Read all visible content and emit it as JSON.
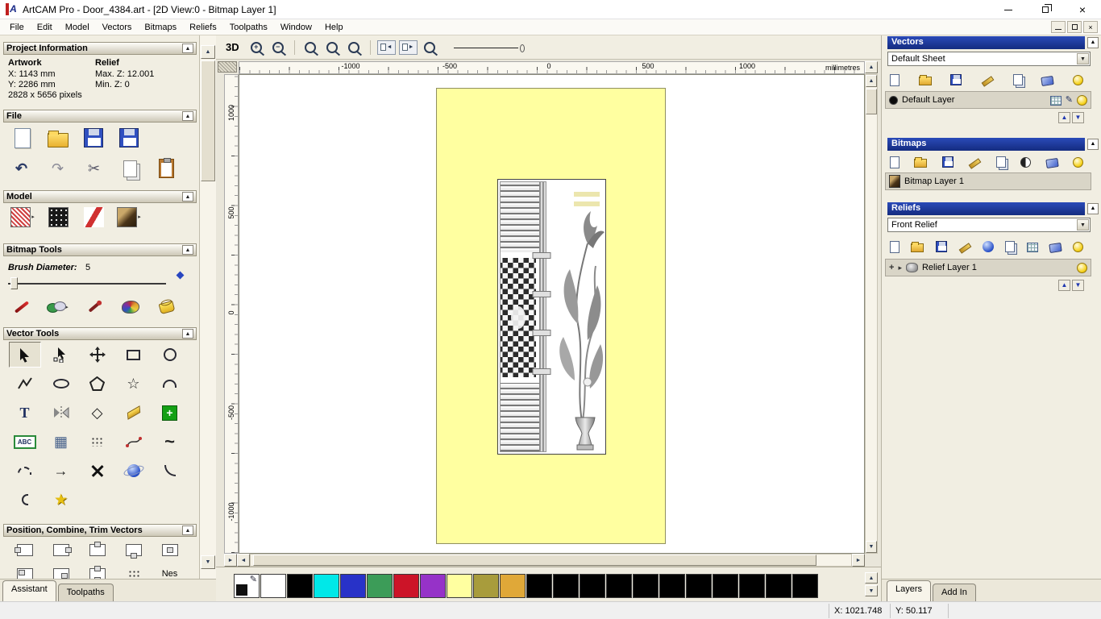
{
  "window": {
    "title": "ArtCAM Pro - Door_4384.art - [2D View:0 - Bitmap Layer 1]"
  },
  "menu": {
    "items": [
      "File",
      "Edit",
      "Model",
      "Vectors",
      "Bitmaps",
      "Reliefs",
      "Toolpaths",
      "Window",
      "Help"
    ]
  },
  "left_panel": {
    "project_information": {
      "title": "Project Information",
      "artwork_label": "Artwork",
      "relief_label": "Relief",
      "artwork_x": "X: 1143 mm",
      "artwork_y": "Y: 2286 mm",
      "artwork_pixels": "2828 x 5656 pixels",
      "relief_max": "Max. Z: 12.001",
      "relief_min": "Min. Z: 0"
    },
    "file_section": {
      "title": "File"
    },
    "model_section": {
      "title": "Model"
    },
    "bitmap_tools": {
      "title": "Bitmap Tools",
      "brush_label": "Brush Diameter:",
      "brush_value": "5"
    },
    "vector_tools": {
      "title": "Vector Tools"
    },
    "position_section": {
      "title": "Position, Combine, Trim Vectors"
    },
    "nest_label": "Nes",
    "tabs": {
      "assistant": "Assistant",
      "toolpaths": "Toolpaths"
    }
  },
  "canvas": {
    "toolbar": {
      "view3d": "3D"
    },
    "rulers": {
      "unit": "millimetres",
      "h_ticks": [
        "-1000",
        "-500",
        "0",
        "500",
        "1000"
      ],
      "v_ticks": [
        "1000",
        "500",
        "0",
        "-500",
        "-1000"
      ]
    }
  },
  "palette": {
    "colors": [
      "#ffffff",
      "#000000",
      "#00e8e8",
      "#2832c8",
      "#3c9c58",
      "#cc1428",
      "#9632c8",
      "#ffffa0",
      "#a89c3c",
      "#e0a838",
      "#000000",
      "#000000",
      "#000000",
      "#000000",
      "#000000",
      "#000000",
      "#000000",
      "#000000",
      "#000000",
      "#000000",
      "#000000"
    ]
  },
  "right_panel": {
    "vectors": {
      "title": "Vectors",
      "sheet": "Default Sheet",
      "layer": "Default Layer"
    },
    "bitmaps": {
      "title": "Bitmaps",
      "layer": "Bitmap Layer 1"
    },
    "reliefs": {
      "title": "Reliefs",
      "relief": "Front Relief",
      "layer": "Relief Layer 1"
    },
    "tabs": {
      "layers": "Layers",
      "addin": "Add In"
    }
  },
  "status_bar": {
    "x": "X: 1021.748",
    "y": "Y: 50.117"
  },
  "icons": {
    "logo": "A",
    "close": "×",
    "collapse": "▲",
    "dropdown": "▼",
    "up": "▲",
    "down": "▼",
    "left": "◄",
    "right": "►",
    "expand": "▸",
    "undo": "↶",
    "redo": "↷",
    "cut": "✂",
    "star": "☆",
    "star_filled": "★",
    "diamond": "◇",
    "grid": "▦",
    "arrow": "→",
    "text_t": "T",
    "abc": "ABC",
    "wave": "~",
    "pencil": "✎",
    "plus": "+",
    "minus": "−"
  }
}
